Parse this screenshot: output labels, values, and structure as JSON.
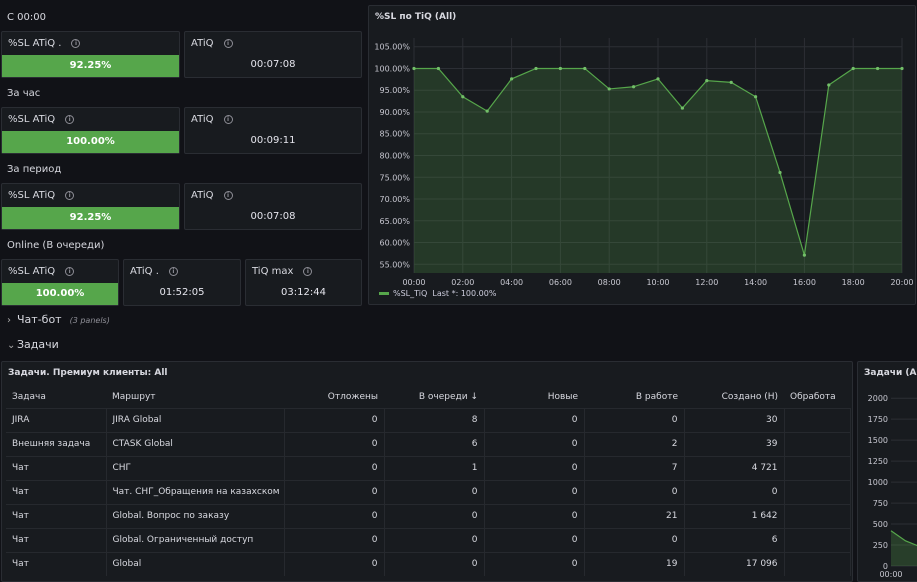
{
  "sections": {
    "since_midnight": "С 00:00",
    "last_hour": "За час",
    "period": "За период",
    "online": "Online (В очереди)"
  },
  "stats": {
    "s1_sl": {
      "title": "%SL ATiQ .",
      "value": "92.25%",
      "percent": 92.25
    },
    "s1_atiq": {
      "title": "ATiQ",
      "value": "00:07:08"
    },
    "s2_sl": {
      "title": "%SL ATiQ",
      "value": "100.00%",
      "percent": 100
    },
    "s2_atiq": {
      "title": "ATiQ",
      "value": "00:09:11"
    },
    "s3_sl": {
      "title": "%SL ATiQ",
      "value": "92.25%",
      "percent": 92.25
    },
    "s3_atiq": {
      "title": "ATiQ",
      "value": "00:07:08"
    },
    "s4_sl": {
      "title": "%SL ATiQ",
      "value": "100.00%",
      "percent": 100
    },
    "s4_atiq": {
      "title": "ATiQ .",
      "value": "01:52:05"
    },
    "s4_tiq": {
      "title": "TiQ max",
      "value": "03:12:44"
    }
  },
  "colors": {
    "accent_green": "#56a64b",
    "panel_bg": "#181b1f",
    "page_bg": "#111217"
  },
  "sl_chart": {
    "title": "%SL по TiQ (All)",
    "legend_label": "%SL_TiQ",
    "legend_last": "Last *: 100.00%"
  },
  "chart_data": [
    {
      "type": "line",
      "title": "%SL по TiQ (All)",
      "series": [
        {
          "name": "%SL_TiQ",
          "values": [
            100,
            100,
            93.5,
            90.2,
            97.6,
            100,
            100,
            100,
            95.3,
            95.8,
            97.6,
            90.9,
            97.2,
            96.8,
            93.5,
            76.1,
            57.1,
            96.2,
            100,
            100,
            100
          ]
        }
      ],
      "x": [
        "00:00",
        "01:00",
        "02:00",
        "03:00",
        "04:00",
        "05:00",
        "06:00",
        "07:00",
        "08:00",
        "09:00",
        "10:00",
        "11:00",
        "12:00",
        "13:00",
        "14:00",
        "15:00",
        "16:00",
        "17:00",
        "18:00",
        "19:00",
        "20:00"
      ],
      "x_ticks": [
        "00:00",
        "02:00",
        "04:00",
        "06:00",
        "08:00",
        "10:00",
        "12:00",
        "14:00",
        "16:00",
        "18:00",
        "20:00"
      ],
      "y_ticks": [
        "55.00%",
        "60.00%",
        "65.00%",
        "70.00%",
        "75.00%",
        "80.00%",
        "85.00%",
        "90.00%",
        "95.00%",
        "100.00%",
        "105.00%"
      ],
      "ylim": [
        53,
        107
      ],
      "legend": "bottom-left"
    },
    {
      "type": "area",
      "title": "Задачи (All)",
      "y_ticks": [
        "0",
        "250",
        "500",
        "750",
        "1000",
        "1250",
        "1500",
        "1750",
        "2000"
      ],
      "x_ticks": [
        "00:00"
      ],
      "series": [
        {
          "name": "",
          "values": [
            420,
            300,
            230
          ]
        }
      ],
      "ylim": [
        0,
        2050
      ]
    }
  ],
  "rows": {
    "chatbot": {
      "label": "Чат-бот",
      "count": "(3 panels)"
    },
    "tasks": {
      "label": "Задачи"
    }
  },
  "tasks_table": {
    "title": "Задачи. Премиум клиенты: All",
    "columns": [
      "Задача",
      "Маршрут",
      "Отложены",
      "В очереди",
      "Новые",
      "В работе",
      "Создано (Н)",
      "Обработа"
    ],
    "sort_indicator": "↓",
    "rows": [
      [
        "JIRA",
        "JIRA Global",
        "0",
        "8",
        "0",
        "0",
        "30",
        ""
      ],
      [
        "Внешняя задача",
        "CTASK Global",
        "0",
        "6",
        "0",
        "2",
        "39",
        ""
      ],
      [
        "Чат",
        "СНГ",
        "0",
        "1",
        "0",
        "7",
        "4 721",
        ""
      ],
      [
        "Чат",
        "Чат. СНГ_Обращения на казахском",
        "0",
        "0",
        "0",
        "0",
        "0",
        ""
      ],
      [
        "Чат",
        "Global. Вопрос по заказу",
        "0",
        "0",
        "0",
        "21",
        "1 642",
        ""
      ],
      [
        "Чат",
        "Global. Ограниченный доступ",
        "0",
        "0",
        "0",
        "0",
        "6",
        ""
      ],
      [
        "Чат",
        "Global",
        "0",
        "0",
        "0",
        "19",
        "17 096",
        ""
      ]
    ]
  },
  "tasks_chart": {
    "title": "Задачи (All)"
  }
}
